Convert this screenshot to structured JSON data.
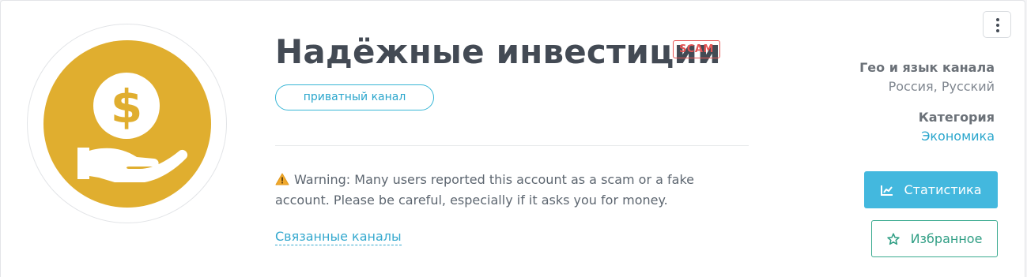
{
  "channel": {
    "title": "Надёжные инвестиции",
    "badge": "SCAM",
    "type_label": "приватный канал",
    "avatar_icon": "dollar-hand-icon"
  },
  "warning": {
    "text": "Warning: Many users reported this account as a scam or a fake account. Please be careful, especially if it asks you for money.",
    "icon": "warning-triangle-icon"
  },
  "related_link": "Связанные каналы",
  "meta": {
    "geo_label": "Гео и язык канала",
    "geo_value": "Россия, Русский",
    "category_label": "Категория",
    "category_value": "Экономика"
  },
  "buttons": {
    "stats_label": "Статистика",
    "stats_icon": "line-chart-icon",
    "favorite_label": "Избранное",
    "favorite_icon": "star-icon",
    "menu_icon": "vertical-dots-icon"
  },
  "colors": {
    "avatar_bg": "#e0ae2f",
    "scam": "#e55454",
    "accent": "#43b8de",
    "favorite": "#3aaa8f",
    "title": "#434a54"
  }
}
